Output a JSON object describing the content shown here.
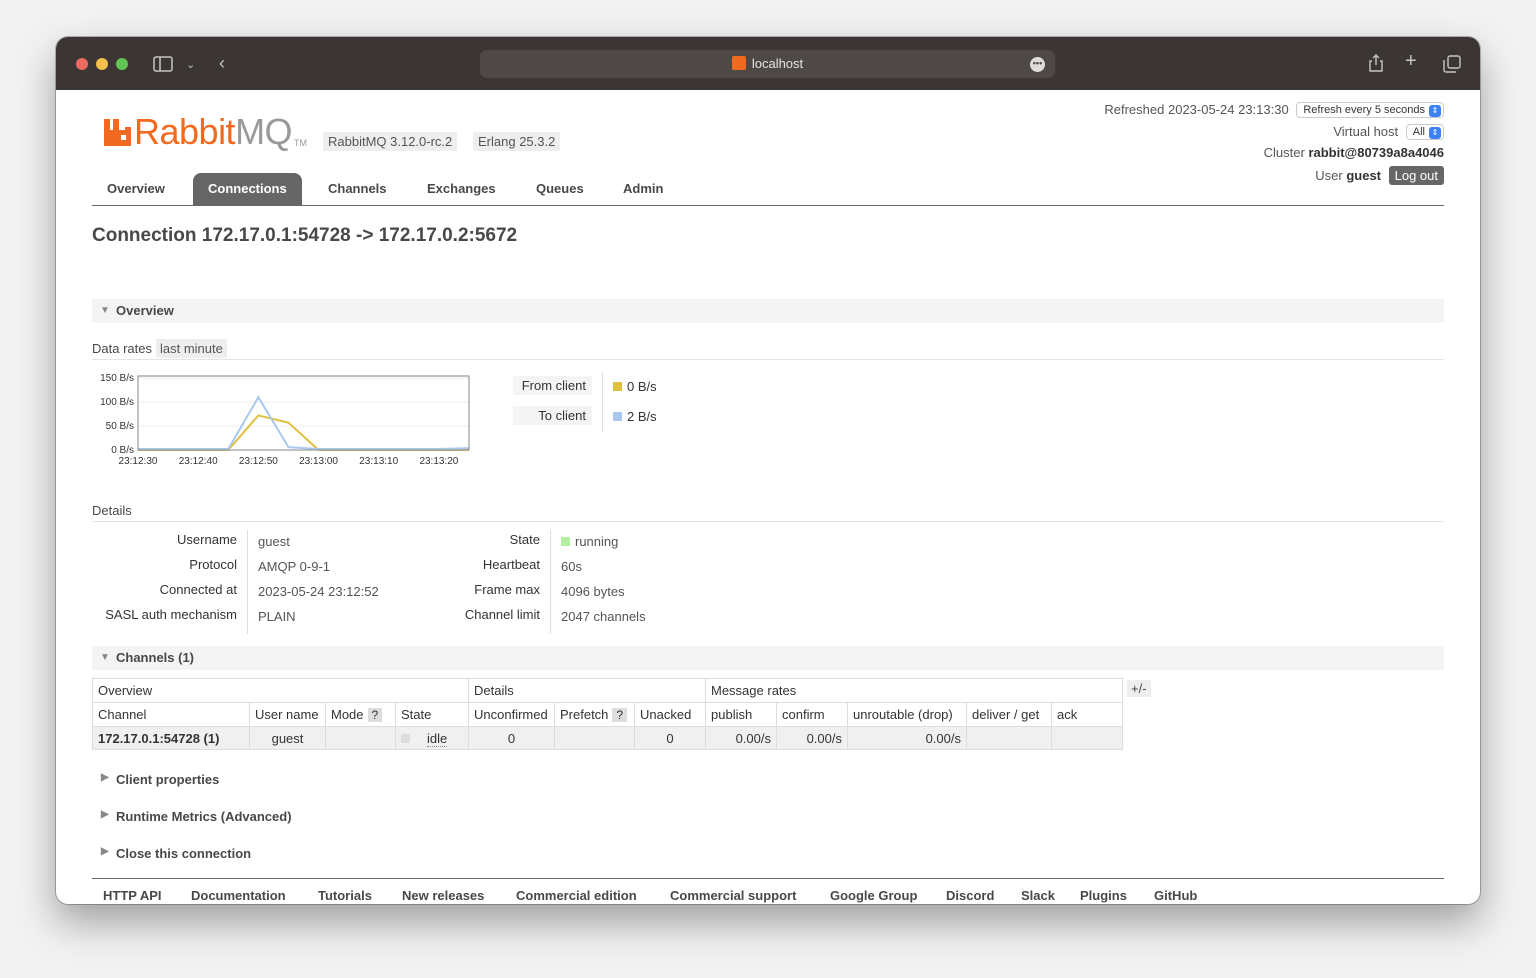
{
  "browser": {
    "url": "localhost"
  },
  "header": {
    "logo_rabbit": "Rabbit",
    "logo_mq": "MQ",
    "logo_tm": "TM",
    "version": "RabbitMQ 3.12.0-rc.2",
    "erlang": "Erlang 25.3.2",
    "refreshed_label": "Refreshed",
    "refreshed_time": "2023-05-24 23:13:30",
    "refresh_option": "Refresh every 5 seconds",
    "vhost_label": "Virtual host",
    "vhost_value": "All",
    "cluster_label": "Cluster",
    "cluster_value": "rabbit@80739a8a4046",
    "user_label": "User",
    "user_value": "guest",
    "logout_label": "Log out"
  },
  "tabs": [
    "Overview",
    "Connections",
    "Channels",
    "Exchanges",
    "Queues",
    "Admin"
  ],
  "active_tab": "Connections",
  "page_title": "Connection 172.17.0.1:54728 -> 172.17.0.2:5672",
  "overview_section": {
    "title": "Overview",
    "data_rates_label": "Data rates",
    "range_label": "last minute"
  },
  "chart_data": {
    "type": "line",
    "title": "",
    "xlabel": "",
    "ylabel": "",
    "y_tick_labels": [
      "150 B/s",
      "100 B/s",
      "50 B/s",
      "0 B/s"
    ],
    "x_tick_labels": [
      "23:12:30",
      "23:12:40",
      "23:12:50",
      "23:13:00",
      "23:13:10",
      "23:13:20"
    ],
    "ylim": [
      0,
      150
    ],
    "x": [
      "23:12:30",
      "23:12:35",
      "23:12:40",
      "23:12:45",
      "23:12:50",
      "23:12:55",
      "23:13:00",
      "23:13:05",
      "23:13:10",
      "23:13:15",
      "23:13:20",
      "23:13:25"
    ],
    "series": [
      {
        "name": "From client",
        "color": "#e0c040",
        "values": [
          0,
          0,
          0,
          0,
          72,
          57,
          0,
          0,
          0,
          0,
          0,
          0
        ]
      },
      {
        "name": "To client",
        "color": "#a8c8ee",
        "values": [
          2,
          2,
          2,
          2,
          110,
          6,
          2,
          2,
          2,
          2,
          2,
          4
        ]
      }
    ],
    "legend": [
      {
        "label": "From client",
        "value": "0 B/s",
        "color": "#e0c040"
      },
      {
        "label": "To client",
        "value": "2 B/s",
        "color": "#a8c8ee"
      }
    ]
  },
  "details": {
    "title": "Details",
    "left": [
      {
        "label": "Username",
        "value": "guest"
      },
      {
        "label": "Protocol",
        "value": "AMQP 0-9-1"
      },
      {
        "label": "Connected at",
        "value": "2023-05-24 23:12:52"
      },
      {
        "label": "SASL auth mechanism",
        "value": "PLAIN"
      }
    ],
    "right": [
      {
        "label": "State",
        "value": "running",
        "color": "#b2f0a0"
      },
      {
        "label": "Heartbeat",
        "value": "60s"
      },
      {
        "label": "Frame max",
        "value": "4096 bytes"
      },
      {
        "label": "Channel limit",
        "value": "2047 channels"
      }
    ]
  },
  "channels": {
    "title": "Channels (1)",
    "groups": [
      "Overview",
      "Details",
      "Message rates"
    ],
    "headers": [
      "Channel",
      "User name",
      "Mode",
      "State",
      "Unconfirmed",
      "Prefetch",
      "Unacked",
      "publish",
      "confirm",
      "unroutable (drop)",
      "deliver / get",
      "ack"
    ],
    "help_mark": "?",
    "toggle_label": "+/-",
    "rows": [
      {
        "channel": "172.17.0.1:54728 (1)",
        "user": "guest",
        "mode": "",
        "state": "idle",
        "unconfirmed": "0",
        "prefetch": "",
        "unacked": "0",
        "publish": "0.00/s",
        "confirm": "0.00/s",
        "unroutable": "0.00/s",
        "deliver": "",
        "ack": ""
      }
    ]
  },
  "collapsed_sections": [
    "Client properties",
    "Runtime Metrics (Advanced)",
    "Close this connection"
  ],
  "footer_links": [
    "HTTP API",
    "Documentation",
    "Tutorials",
    "New releases",
    "Commercial edition",
    "Commercial support",
    "Google Group",
    "Discord",
    "Slack",
    "Plugins",
    "GitHub"
  ]
}
